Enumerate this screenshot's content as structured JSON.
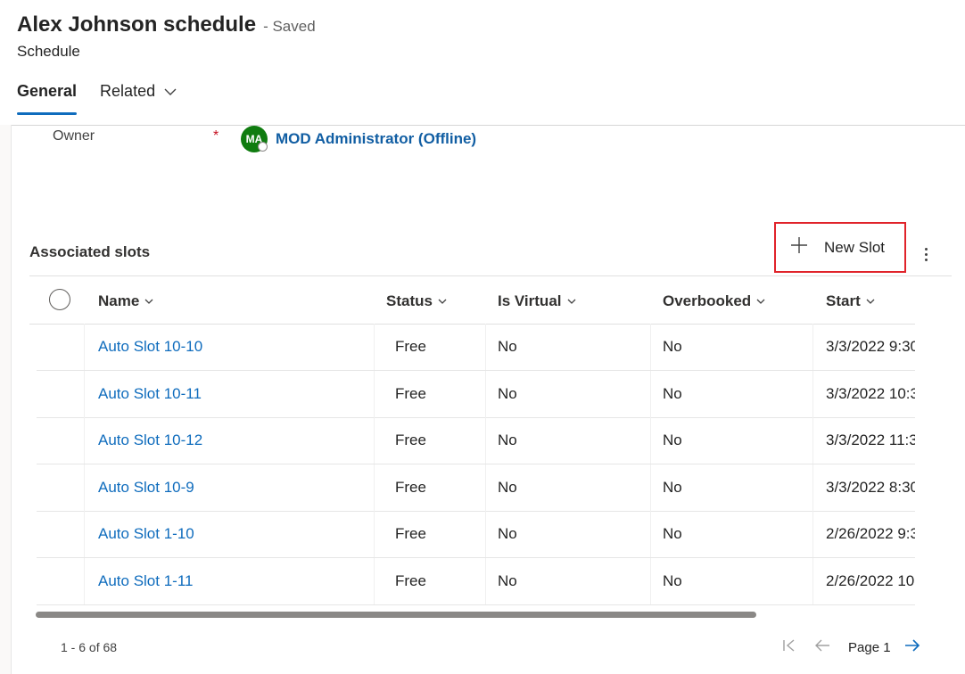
{
  "header": {
    "title": "Alex Johnson schedule",
    "save_status": "- Saved",
    "entity": "Schedule",
    "tabs": [
      {
        "label": "General",
        "active": true
      },
      {
        "label": "Related",
        "active": false
      }
    ]
  },
  "form": {
    "owner_label": "Owner",
    "required_mark": "*",
    "owner_initials": "MA",
    "owner_name": "MOD Administrator (Offline)"
  },
  "subgrid": {
    "title": "Associated slots",
    "new_button": "New Slot",
    "columns": [
      "Name",
      "Status",
      "Is Virtual",
      "Overbooked",
      "Start"
    ],
    "rows": [
      {
        "name": "Auto Slot 10-10",
        "status": "Free",
        "virtual": "No",
        "overbooked": "No",
        "start": "3/3/2022 9:30"
      },
      {
        "name": "Auto Slot 10-11",
        "status": "Free",
        "virtual": "No",
        "overbooked": "No",
        "start": "3/3/2022 10:3"
      },
      {
        "name": "Auto Slot 10-12",
        "status": "Free",
        "virtual": "No",
        "overbooked": "No",
        "start": "3/3/2022 11:3"
      },
      {
        "name": "Auto Slot 10-9",
        "status": "Free",
        "virtual": "No",
        "overbooked": "No",
        "start": "3/3/2022 8:30"
      },
      {
        "name": "Auto Slot 1-10",
        "status": "Free",
        "virtual": "No",
        "overbooked": "No",
        "start": "2/26/2022 9:3"
      },
      {
        "name": "Auto Slot 1-11",
        "status": "Free",
        "virtual": "No",
        "overbooked": "No",
        "start": "2/26/2022 10"
      }
    ],
    "record_count": "1 - 6 of 68",
    "page_label": "Page 1"
  },
  "colors": {
    "accent": "#0f6cbd",
    "link": "#0f6cbd",
    "highlight_border": "#e0232a",
    "avatar_bg": "#107c10"
  },
  "icons": {
    "related_tab": "chevron-down-icon",
    "new_button": "plus-icon",
    "more": "more-vertical-icon",
    "sort": "chevron-down-icon",
    "first_page": "first-page-icon",
    "prev_page": "arrow-left-icon",
    "next_page": "arrow-right-icon"
  }
}
